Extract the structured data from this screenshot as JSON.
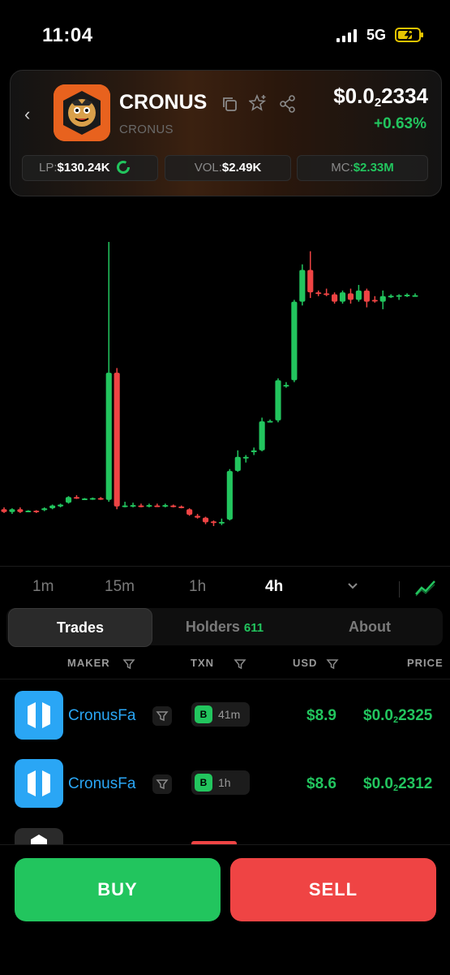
{
  "status_bar": {
    "time": "11:04",
    "network": "5G"
  },
  "header": {
    "token_name": "CRONUS",
    "token_symbol": "CRONUS",
    "price_prefix": "$0.0",
    "price_subscript": "2",
    "price_suffix": "2334",
    "change": "+0.63%",
    "change_color": "#22c55e",
    "stats": {
      "lp_label": "LP:",
      "lp_value": "$130.24K",
      "vol_label": "VOL:",
      "vol_value": "$2.49K",
      "mc_label": "MC:",
      "mc_value": "$2.33M"
    },
    "icons": [
      "back-icon",
      "copy-icon",
      "star-add-icon",
      "share-icon",
      "lp-ring-icon"
    ]
  },
  "chart_data": {
    "type": "candlestick",
    "up_color": "#22c55e",
    "down_color": "#ef4444",
    "candles": [
      {
        "o": 14,
        "h": 16,
        "l": 10,
        "c": 11
      },
      {
        "o": 11,
        "h": 15,
        "l": 9,
        "c": 14
      },
      {
        "o": 14,
        "h": 16,
        "l": 10,
        "c": 11
      },
      {
        "o": 12,
        "h": 13,
        "l": 11,
        "c": 12.5
      },
      {
        "o": 12.5,
        "h": 13,
        "l": 10,
        "c": 12
      },
      {
        "o": 13,
        "h": 16,
        "l": 12,
        "c": 15
      },
      {
        "o": 15,
        "h": 19,
        "l": 14,
        "c": 18
      },
      {
        "o": 17,
        "h": 20,
        "l": 16,
        "c": 19
      },
      {
        "o": 21,
        "h": 28,
        "l": 20,
        "c": 27
      },
      {
        "o": 27,
        "h": 29,
        "l": 25,
        "c": 26
      },
      {
        "o": 25,
        "h": 26,
        "l": 24,
        "c": 25.5
      },
      {
        "o": 25,
        "h": 26.5,
        "l": 24,
        "c": 26
      },
      {
        "o": 26,
        "h": 27,
        "l": 24,
        "c": 24.5
      },
      {
        "o": 24,
        "h": 300,
        "l": 22,
        "c": 160
      },
      {
        "o": 160,
        "h": 165,
        "l": 14,
        "c": 17
      },
      {
        "o": 17,
        "h": 22,
        "l": 16,
        "c": 18
      },
      {
        "o": 18,
        "h": 21,
        "l": 16,
        "c": 18.5
      },
      {
        "o": 18,
        "h": 20,
        "l": 16,
        "c": 17.5
      },
      {
        "o": 18,
        "h": 20,
        "l": 16,
        "c": 18.5
      },
      {
        "o": 18,
        "h": 20,
        "l": 17,
        "c": 17
      },
      {
        "o": 18,
        "h": 20,
        "l": 16,
        "c": 18.5
      },
      {
        "o": 18,
        "h": 19,
        "l": 16,
        "c": 16.5
      },
      {
        "o": 17,
        "h": 18,
        "l": 15,
        "c": 15.5
      },
      {
        "o": 14,
        "h": 15,
        "l": 7,
        "c": 8
      },
      {
        "o": 7,
        "h": 9,
        "l": 4,
        "c": 5
      },
      {
        "o": 5,
        "h": 6,
        "l": -2,
        "c": 0
      },
      {
        "o": 1,
        "h": 2,
        "l": -4,
        "c": 0
      },
      {
        "o": 0,
        "h": 4,
        "l": -3,
        "c": 0.5
      },
      {
        "o": 3,
        "h": 57,
        "l": 2,
        "c": 55
      },
      {
        "o": 55,
        "h": 77,
        "l": 54,
        "c": 70
      },
      {
        "o": 70,
        "h": 72,
        "l": 64,
        "c": 70
      },
      {
        "o": 75,
        "h": 80,
        "l": 72,
        "c": 77
      },
      {
        "o": 77,
        "h": 112,
        "l": 76,
        "c": 108
      },
      {
        "o": 108,
        "h": 110,
        "l": 107,
        "c": 108.5
      },
      {
        "o": 109,
        "h": 154,
        "l": 107,
        "c": 152
      },
      {
        "o": 146,
        "h": 150,
        "l": 144,
        "c": 147
      },
      {
        "o": 152,
        "h": 238,
        "l": 150,
        "c": 236
      },
      {
        "o": 236,
        "h": 276,
        "l": 232,
        "c": 270
      },
      {
        "o": 270,
        "h": 290,
        "l": 240,
        "c": 246
      },
      {
        "o": 246,
        "h": 248,
        "l": 242,
        "c": 245
      },
      {
        "o": 245,
        "h": 250,
        "l": 242,
        "c": 244
      },
      {
        "o": 244,
        "h": 246,
        "l": 234,
        "c": 236
      },
      {
        "o": 236,
        "h": 248,
        "l": 234,
        "c": 246
      },
      {
        "o": 245,
        "h": 250,
        "l": 234,
        "c": 238
      },
      {
        "o": 238,
        "h": 254,
        "l": 236,
        "c": 248
      },
      {
        "o": 248,
        "h": 250,
        "l": 230,
        "c": 236
      },
      {
        "o": 238,
        "h": 242,
        "l": 235,
        "c": 237
      },
      {
        "o": 236,
        "h": 248,
        "l": 228,
        "c": 242
      },
      {
        "o": 242,
        "h": 244,
        "l": 240,
        "c": 242.5
      },
      {
        "o": 243,
        "h": 244,
        "l": 238,
        "c": 243
      },
      {
        "o": 243,
        "h": 245,
        "l": 241,
        "c": 243.5
      },
      {
        "o": 243,
        "h": 245,
        "l": 242,
        "c": 243
      }
    ]
  },
  "timeframes": [
    "1m",
    "15m",
    "1h",
    "4h"
  ],
  "active_timeframe": "4h",
  "tabs": {
    "trades": "Trades",
    "holders": "Holders",
    "holders_count": "611",
    "about": "About"
  },
  "table": {
    "headers": {
      "maker": "MAKER",
      "txn": "TXN",
      "usd": "USD",
      "price": "PRICE"
    },
    "rows": [
      {
        "maker": "CronusFa",
        "type": "B",
        "age": "41m",
        "usd": "$8.9",
        "price_prefix": "$0.0",
        "price_sub": "2",
        "price_suffix": "2325"
      },
      {
        "maker": "CronusFa",
        "type": "B",
        "age": "1h",
        "usd": "$8.6",
        "price_prefix": "$0.0",
        "price_sub": "2",
        "price_suffix": "2312"
      }
    ]
  },
  "actions": {
    "buy": "BUY",
    "sell": "SELL"
  },
  "colors": {
    "up": "#22c55e",
    "down": "#ef4444",
    "maker_blue": "#2aa6f5"
  }
}
